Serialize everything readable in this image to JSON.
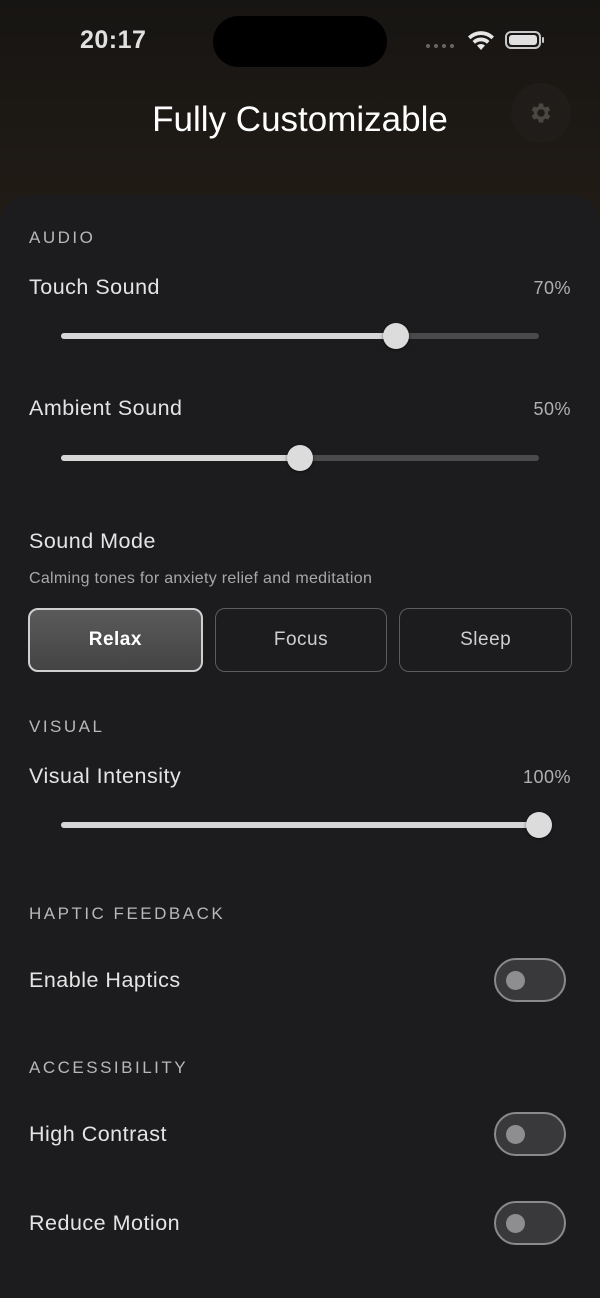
{
  "status_bar": {
    "time": "20:17"
  },
  "header": {
    "title": "Fully Customizable",
    "settings_icon": "gear-icon"
  },
  "audio": {
    "section_title": "AUDIO",
    "touch_sound": {
      "label": "Touch Sound",
      "value_text": "70%",
      "value": 0.7
    },
    "ambient_sound": {
      "label": "Ambient Sound",
      "value_text": "50%",
      "value": 0.5
    },
    "sound_mode": {
      "label": "Sound Mode",
      "description": "Calming tones for anxiety relief and meditation",
      "options": [
        "Relax",
        "Focus",
        "Sleep"
      ],
      "selected": "Relax"
    }
  },
  "visual": {
    "section_title": "VISUAL",
    "intensity": {
      "label": "Visual Intensity",
      "value_text": "100%",
      "value": 1.0
    }
  },
  "haptic": {
    "section_title": "HAPTIC FEEDBACK",
    "enable": {
      "label": "Enable Haptics",
      "on": false
    }
  },
  "accessibility": {
    "section_title": "ACCESSIBILITY",
    "high_contrast": {
      "label": "High Contrast",
      "on": false
    },
    "reduce_motion": {
      "label": "Reduce Motion",
      "on": false
    }
  },
  "colors": {
    "sheet": "#1c1c1e",
    "track": "#4a4a4c",
    "fill": "#d6d6d6"
  }
}
